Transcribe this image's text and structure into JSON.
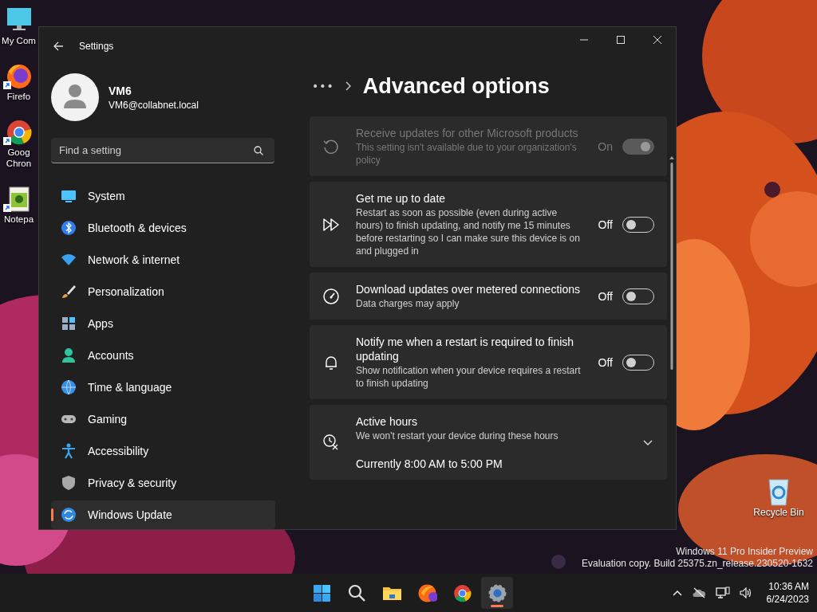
{
  "desktop": {
    "icons": [
      {
        "kind": "computer",
        "shortcut": false,
        "lines": [
          "My Com"
        ]
      },
      {
        "kind": "firefox",
        "shortcut": true,
        "lines": [
          "Firefo"
        ]
      },
      {
        "kind": "chrome",
        "shortcut": true,
        "lines": [
          "Goog",
          "Chron"
        ]
      },
      {
        "kind": "notepad",
        "shortcut": true,
        "lines": [
          "Notepa"
        ]
      }
    ],
    "recycle_bin": {
      "label": "Recycle Bin"
    },
    "watermark": [
      "Windows 11 Pro Insider Preview",
      "Evaluation copy. Build 25375.zn_release.230520-1632"
    ]
  },
  "window": {
    "title": "Settings",
    "user": {
      "name": "VM6",
      "email": "VM6@collabnet.local"
    },
    "search": {
      "placeholder": "Find a setting"
    },
    "nav": [
      {
        "kind": "system",
        "label": "System",
        "selected": false
      },
      {
        "kind": "bluetooth",
        "label": "Bluetooth & devices",
        "selected": false
      },
      {
        "kind": "network",
        "label": "Network & internet",
        "selected": false
      },
      {
        "kind": "brush",
        "label": "Personalization",
        "selected": false
      },
      {
        "kind": "apps",
        "label": "Apps",
        "selected": false
      },
      {
        "kind": "accounts",
        "label": "Accounts",
        "selected": false
      },
      {
        "kind": "time",
        "label": "Time & language",
        "selected": false
      },
      {
        "kind": "gaming",
        "label": "Gaming",
        "selected": false
      },
      {
        "kind": "accessibility",
        "label": "Accessibility",
        "selected": false
      },
      {
        "kind": "privacy",
        "label": "Privacy & security",
        "selected": false
      },
      {
        "kind": "update",
        "label": "Windows Update",
        "selected": true
      }
    ],
    "breadcrumb": {
      "more": "•••",
      "page": "Advanced options"
    },
    "settings": [
      {
        "kind": "toggle",
        "disabled": true,
        "on": true,
        "title": "Receive updates for other Microsoft products",
        "description": "This setting isn't available due to your organization's policy",
        "state_label": "On"
      },
      {
        "kind": "toggle",
        "disabled": false,
        "on": false,
        "title": "Get me up to date",
        "description": "Restart as soon as possible (even during active hours) to finish updating, and notify me 15 minutes before restarting so I can make sure this device is on and plugged in",
        "state_label": "Off"
      },
      {
        "kind": "toggle",
        "disabled": false,
        "on": false,
        "title": "Download updates over metered connections",
        "description": "Data charges may apply",
        "state_label": "Off"
      },
      {
        "kind": "toggle",
        "disabled": false,
        "on": false,
        "title": "Notify me when a restart is required to finish updating",
        "description": "Show notification when your device requires a restart to finish updating",
        "state_label": "Off"
      },
      {
        "kind": "expander",
        "expanded": false,
        "title": "Active hours",
        "description": "We won't restart your device during these hours",
        "value": "Currently 8:00 AM to 5:00 PM"
      }
    ]
  },
  "taskbar": {
    "apps": [
      {
        "kind": "start",
        "active": false
      },
      {
        "kind": "search",
        "active": false
      },
      {
        "kind": "files",
        "active": false
      },
      {
        "kind": "firefox",
        "active": false
      },
      {
        "kind": "chrome",
        "active": false
      },
      {
        "kind": "settings",
        "active": true
      }
    ],
    "time": "10:36 AM",
    "date": "6/24/2023"
  }
}
